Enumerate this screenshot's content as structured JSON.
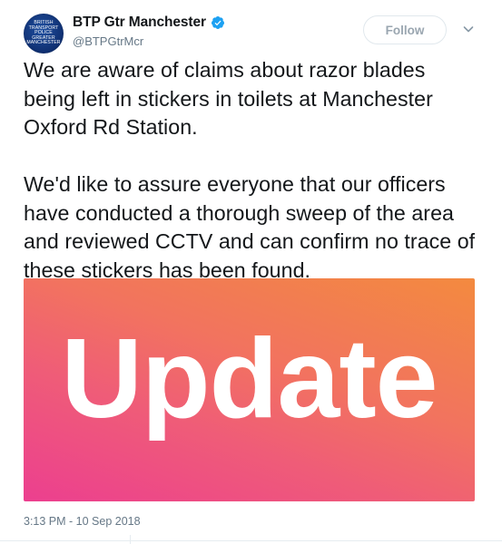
{
  "account": {
    "display_name": "BTP Gtr Manchester",
    "handle": "@BTPGtrMcr",
    "avatar_text": "BRITISH\nTRANSPORT\nPOLICE\nGREATER\nMANCHESTER",
    "verified": true,
    "verified_icon": "verified-badge-icon"
  },
  "actions": {
    "follow_label": "Follow",
    "more_icon": "chevron-down-icon"
  },
  "tweet": {
    "paragraphs": [
      "We are aware of claims about razor blades being left in stickers in toilets at Manchester Oxford Rd Station.",
      "We'd like to assure everyone that our officers have conducted a thorough sweep of the area and reviewed CCTV and can confirm no trace of these stickers has been found."
    ],
    "media_text": "Update",
    "timestamp": "3:13 PM - 10 Sep 2018"
  },
  "colors": {
    "accent": "#1da1f2",
    "text": "#14171a",
    "muted": "#657786",
    "media_gradient_start": "#ec3f8f",
    "media_gradient_end": "#f38a3f"
  }
}
